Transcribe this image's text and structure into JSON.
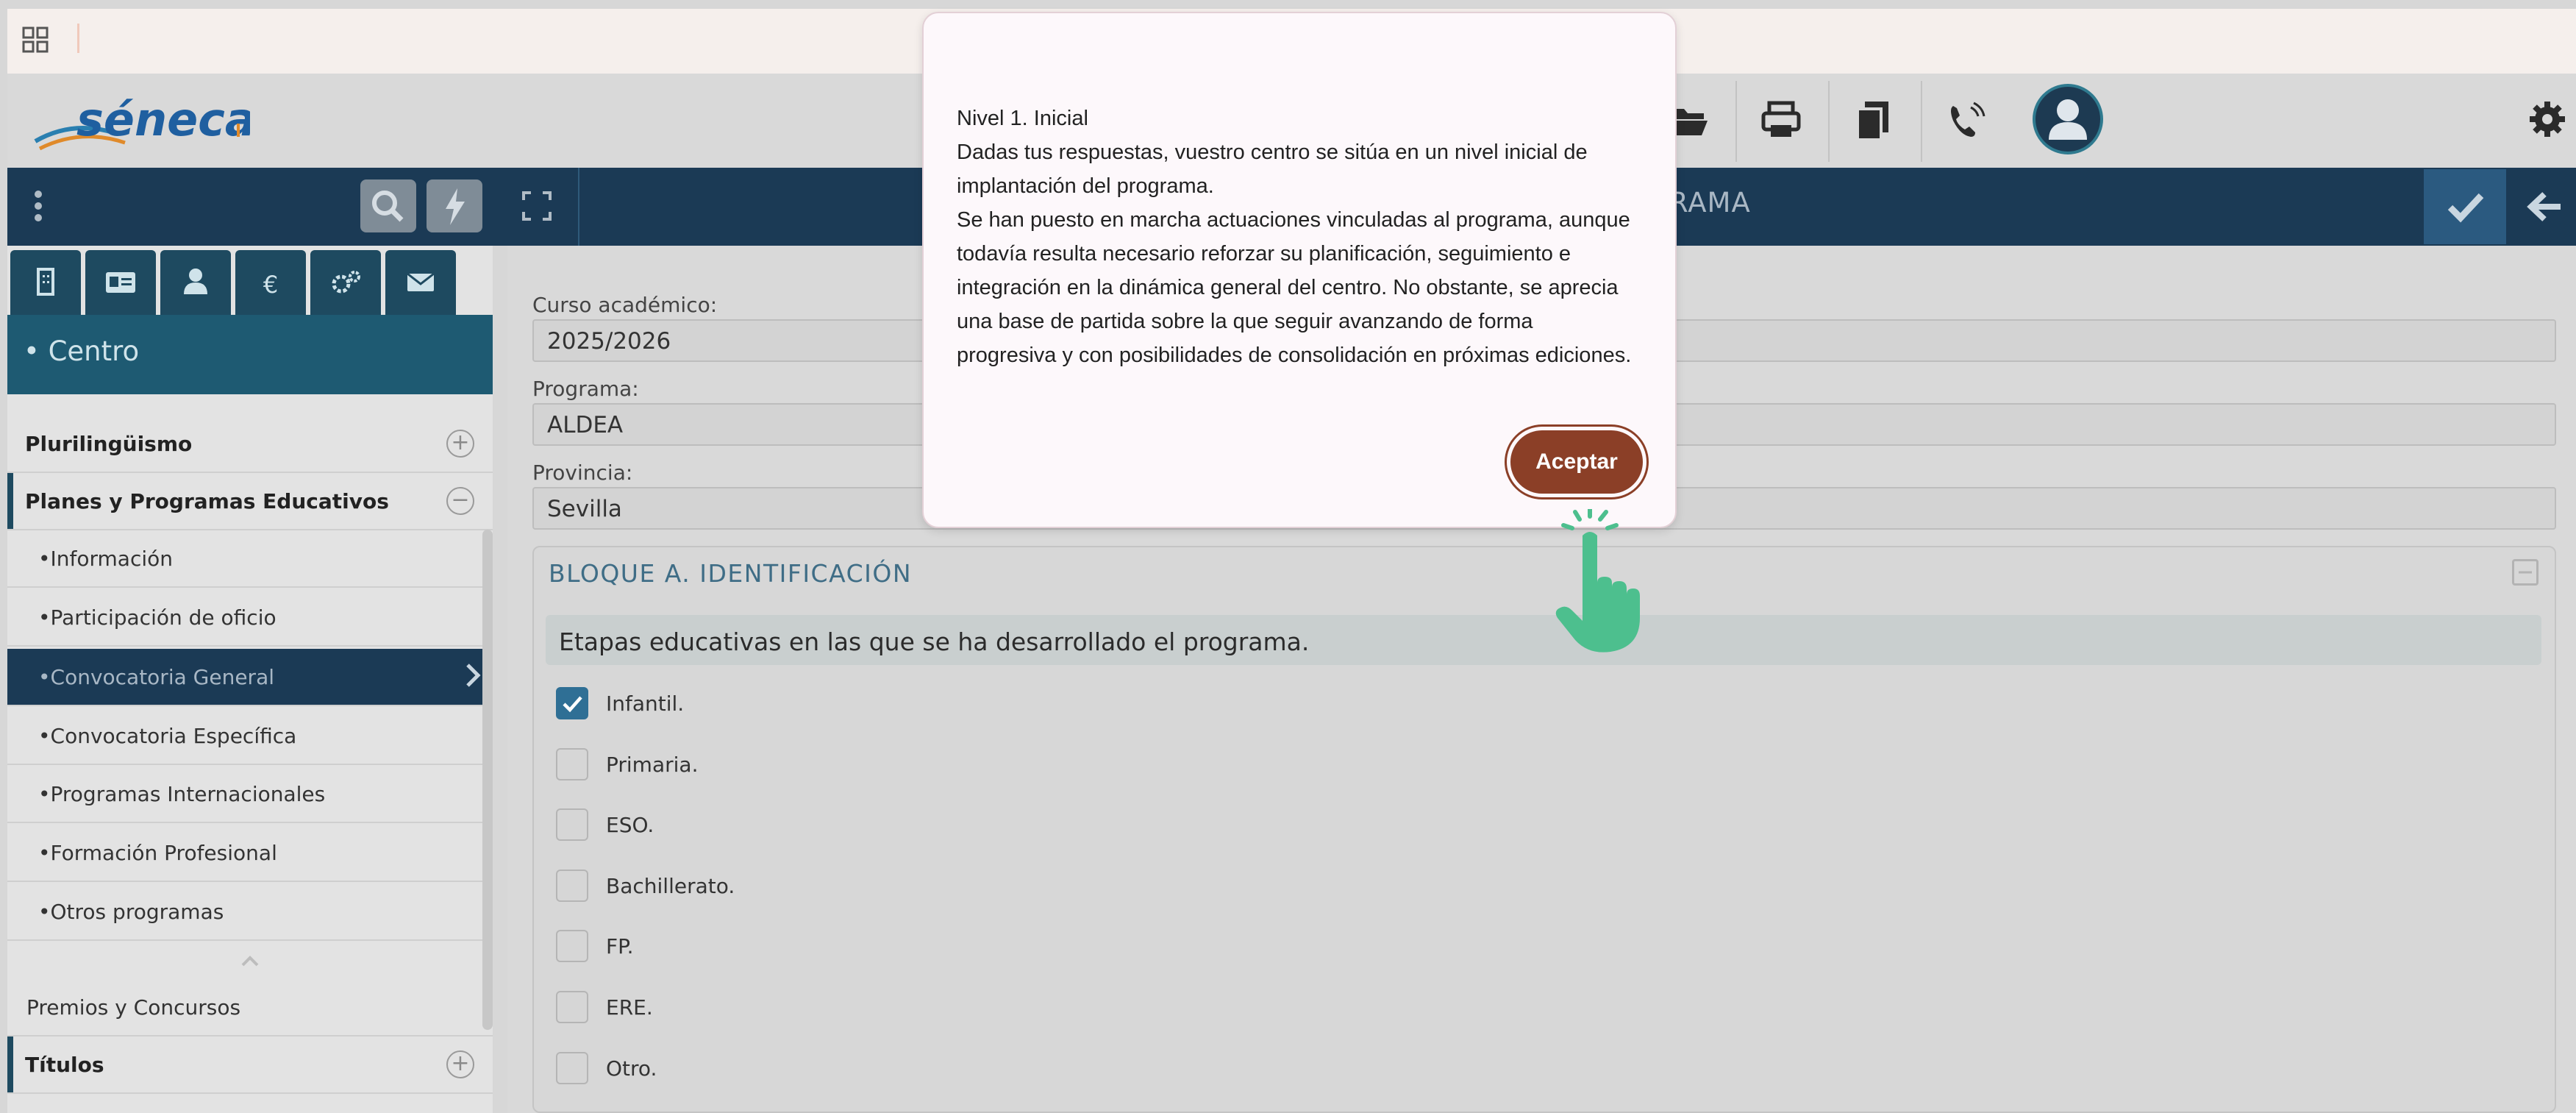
{
  "header": {
    "logo_text": "séneca"
  },
  "mainbar": {
    "title": "RAMA"
  },
  "sidebar": {
    "section_title": "• Centro",
    "items": [
      {
        "label": "Plurilingüismo",
        "toggle": "+"
      },
      {
        "label": "Planes y Programas Educativos",
        "toggle": "−"
      },
      {
        "label": "•Información"
      },
      {
        "label": "•Participación de oficio"
      },
      {
        "label": "•Convocatoria General"
      },
      {
        "label": "•Convocatoria Específica"
      },
      {
        "label": "•Programas Internacionales"
      },
      {
        "label": "•Formación Profesional"
      },
      {
        "label": "•Otros programas"
      },
      {
        "label": "Premios y Concursos"
      },
      {
        "label": "Títulos",
        "toggle": "+"
      }
    ]
  },
  "form": {
    "curso_label": "Curso académico:",
    "curso_value": "2025/2026",
    "programa_label": "Programa:",
    "programa_value": "ALDEA",
    "provincia_label": "Provincia:",
    "provincia_value": "Sevilla"
  },
  "bloque": {
    "title": "BLOQUE A. IDENTIFICACIÓN",
    "question": "Etapas educativas en las que se ha desarrollado el programa.",
    "options": [
      {
        "label": "Infantil.",
        "checked": true
      },
      {
        "label": "Primaria.",
        "checked": false
      },
      {
        "label": "ESO.",
        "checked": false
      },
      {
        "label": "Bachillerato.",
        "checked": false
      },
      {
        "label": "FP.",
        "checked": false
      },
      {
        "label": "ERE.",
        "checked": false
      },
      {
        "label": "Otro.",
        "checked": false
      }
    ]
  },
  "modal": {
    "lines": [
      "Nivel 1. Inicial",
      "Dadas tus respuestas, vuestro centro se sitúa en un nivel inicial de",
      "implantación del programa.",
      "Se han puesto en marcha actuaciones vinculadas al programa, aunque",
      "todavía resulta necesario reforzar su planificación, seguimiento e",
      "integración en la dinámica general del centro. No obstante, se aprecia",
      "una base de partida sobre la que seguir avanzando de forma",
      "progresiva y con posibilidades de consolidación en próximas ediciones."
    ],
    "accept_label": "Aceptar"
  },
  "colors": {
    "accent": "#8b3f27",
    "navy": "#1b3a55",
    "teal": "#1e5a72",
    "cursor": "#4dbf8e"
  }
}
